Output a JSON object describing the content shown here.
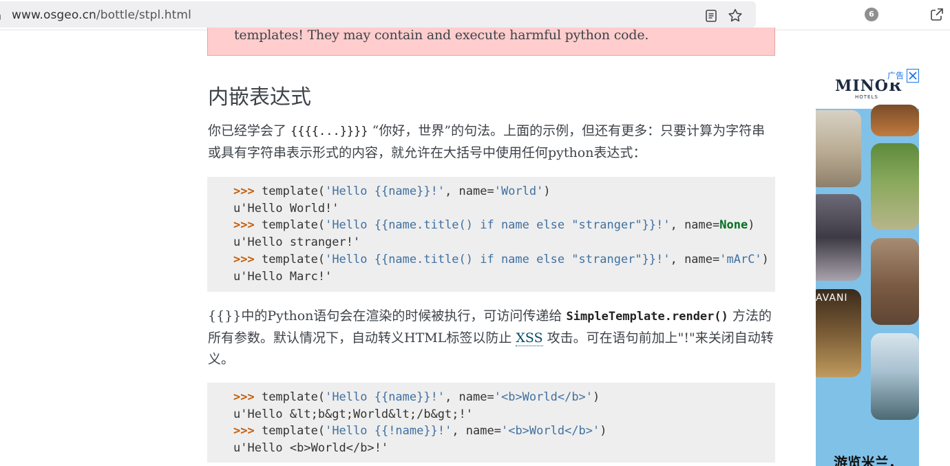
{
  "browser": {
    "url_host": "www.osgeo.cn",
    "url_path": "/bottle/stpl.html",
    "tab_badge": "6"
  },
  "warning": {
    "text": "templates! They may contain and execute harmful python code."
  },
  "section": {
    "title": "内嵌表达式"
  },
  "para1": {
    "part1": "你已经学会了 ",
    "code": "{{{{...}}}}",
    "part2": " “你好，世界”的句法。上面的示例，但还有更多：只要计算为字符串或具有字符串表示形式的内容，就允许在大括号中使用任何python表达式："
  },
  "code1": {
    "lines": [
      {
        "prompt": ">>>",
        "pre": " template(",
        "s1": "'Hello {{name}}!'",
        "mid": ", name=",
        "s2": "'World'",
        "post": ")"
      },
      {
        "output": "u'Hello World!'"
      },
      {
        "prompt": ">>>",
        "pre": " template(",
        "s1": "'Hello {{name.title() if name else \"stranger\"}}!'",
        "mid": ", name=",
        "kw": "None",
        "post": ")"
      },
      {
        "output": "u'Hello stranger!'"
      },
      {
        "prompt": ">>>",
        "pre": " template(",
        "s1": "'Hello {{name.title() if name else \"stranger\"}}!'",
        "mid": ", name=",
        "s2": "'mArC'",
        "post": ")"
      },
      {
        "output": "u'Hello Marc!'"
      }
    ]
  },
  "para2": {
    "part1": "{{}}中的Python语句会在渲染的时候被执行，可访问传递给 ",
    "code": "SimpleTemplate.render()",
    "part2": " 方法的所有参数。默认情况下，自动转义HTML标签以防止 ",
    "link": "XSS",
    "part3": " 攻击。可在语句前加上\"!\"来关闭自动转义。"
  },
  "code2": {
    "lines": [
      {
        "prompt": ">>>",
        "pre": " template(",
        "s1": "'Hello {{name}}!'",
        "mid": ", name=",
        "s2": "'<b>World</b>'",
        "post": ")"
      },
      {
        "output": "u'Hello &lt;b&gt;World&lt;/b&gt;!'"
      },
      {
        "prompt": ">>>",
        "pre": " template(",
        "s1": "'Hello {{!name}}!'",
        "mid": ", name=",
        "s2": "'<b>World</b>'",
        "post": ")"
      },
      {
        "output": "u'Hello <b>World</b>!'"
      }
    ]
  },
  "ad": {
    "label": "广告",
    "brand": "MINOR",
    "brand_sub": "HOTELS",
    "brand2": "AVANI",
    "caption": "游览米兰，"
  },
  "colors": {
    "warning_bg": "#ffcdcd",
    "code_bg": "#eeeeee",
    "prompt": "#c65d09",
    "string": "#4070a0",
    "keyword": "#007020",
    "link": "#004b6b",
    "ad_bg": "#80c1e8"
  }
}
